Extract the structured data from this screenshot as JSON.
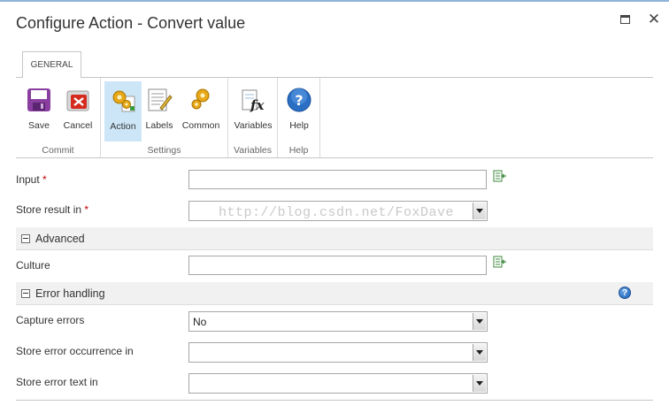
{
  "window": {
    "title": "Configure Action - Convert value",
    "maximize_icon": "maximize-icon",
    "close_glyph": "✕"
  },
  "ribbon": {
    "tab_label": "GENERAL",
    "groups": [
      {
        "label": "Commit",
        "buttons": [
          {
            "label": "Save",
            "icon": "save-icon"
          },
          {
            "label": "Cancel",
            "icon": "cancel-icon"
          }
        ]
      },
      {
        "label": "Settings",
        "buttons": [
          {
            "label": "Action",
            "icon": "action-gears-icon",
            "active": true
          },
          {
            "label": "Labels",
            "icon": "labels-icon"
          },
          {
            "label": "Common",
            "icon": "common-gears-icon"
          }
        ]
      },
      {
        "label": "Variables",
        "buttons": [
          {
            "label": "Variables",
            "icon": "variables-fx-icon"
          }
        ]
      },
      {
        "label": "Help",
        "buttons": [
          {
            "label": "Help",
            "icon": "help-icon"
          }
        ]
      }
    ]
  },
  "form": {
    "input": {
      "label": "Input",
      "required_mark": "*",
      "value": ""
    },
    "store_result": {
      "label": "Store result in",
      "required_mark": "*",
      "value": ""
    },
    "watermark": "http://blog.csdn.net/FoxDave",
    "advanced_section": {
      "title": "Advanced"
    },
    "culture": {
      "label": "Culture",
      "value": ""
    },
    "error_section": {
      "title": "Error handling",
      "help_glyph": "?"
    },
    "capture_errors": {
      "label": "Capture errors",
      "value": "No"
    },
    "store_error_occurrence": {
      "label": "Store error occurrence in",
      "value": ""
    },
    "store_error_text": {
      "label": "Store error text in",
      "value": ""
    }
  },
  "colors": {
    "accent": "#cde6f7",
    "required": "#c00000",
    "section_bg": "#f1f1f1"
  }
}
